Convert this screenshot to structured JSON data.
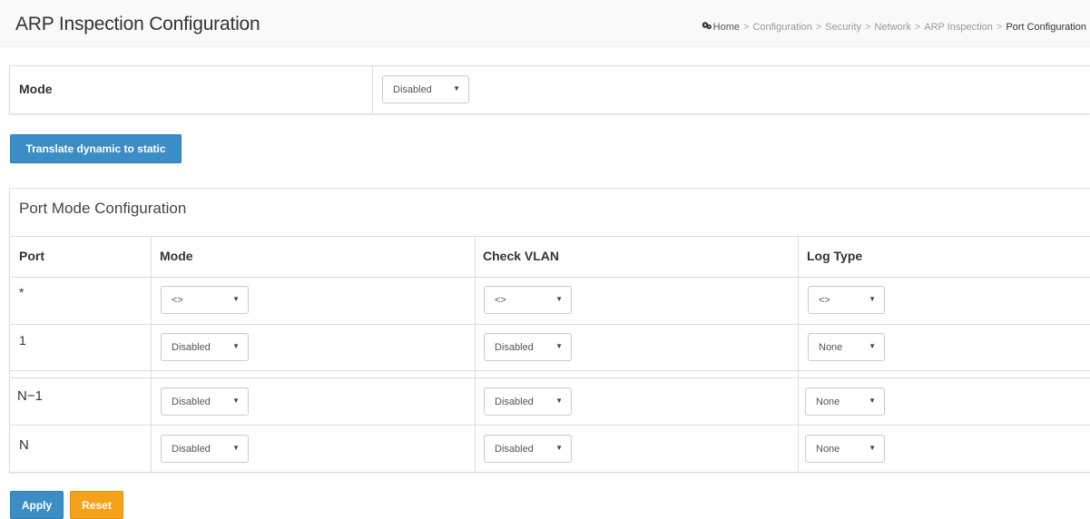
{
  "header": {
    "title": "ARP Inspection Configuration",
    "breadcrumb": {
      "home": "Home",
      "items": [
        "Configuration",
        "Security",
        "Network",
        "ARP Inspection"
      ],
      "current": "Port Configuration",
      "separator": ">"
    }
  },
  "mode_panel": {
    "label": "Mode",
    "select_value": "Disabled"
  },
  "buttons": {
    "translate": "Translate dynamic to static",
    "apply": "Apply",
    "reset": "Reset"
  },
  "port_panel": {
    "title": "Port Mode Configuration",
    "columns": [
      "Port",
      "Mode",
      "Check VLAN",
      "Log Type"
    ],
    "rows": [
      {
        "port": "*",
        "mode": "<>",
        "check_vlan": "<>",
        "log_type": "<>"
      },
      {
        "port": "1",
        "mode": "Disabled",
        "check_vlan": "Disabled",
        "log_type": "None"
      },
      {
        "port": "N−1",
        "mode": "Disabled",
        "check_vlan": "Disabled",
        "log_type": "None"
      },
      {
        "port": "N",
        "mode": "Disabled",
        "check_vlan": "Disabled",
        "log_type": "None"
      }
    ]
  },
  "colors": {
    "primary_button": "#3b8dc5",
    "warning_button": "#f5a21a",
    "border": "#dddddd",
    "header_bg": "#f9f9f9"
  },
  "icons": {
    "home": "home-icon",
    "dropdown": "chevron-down-icon"
  }
}
